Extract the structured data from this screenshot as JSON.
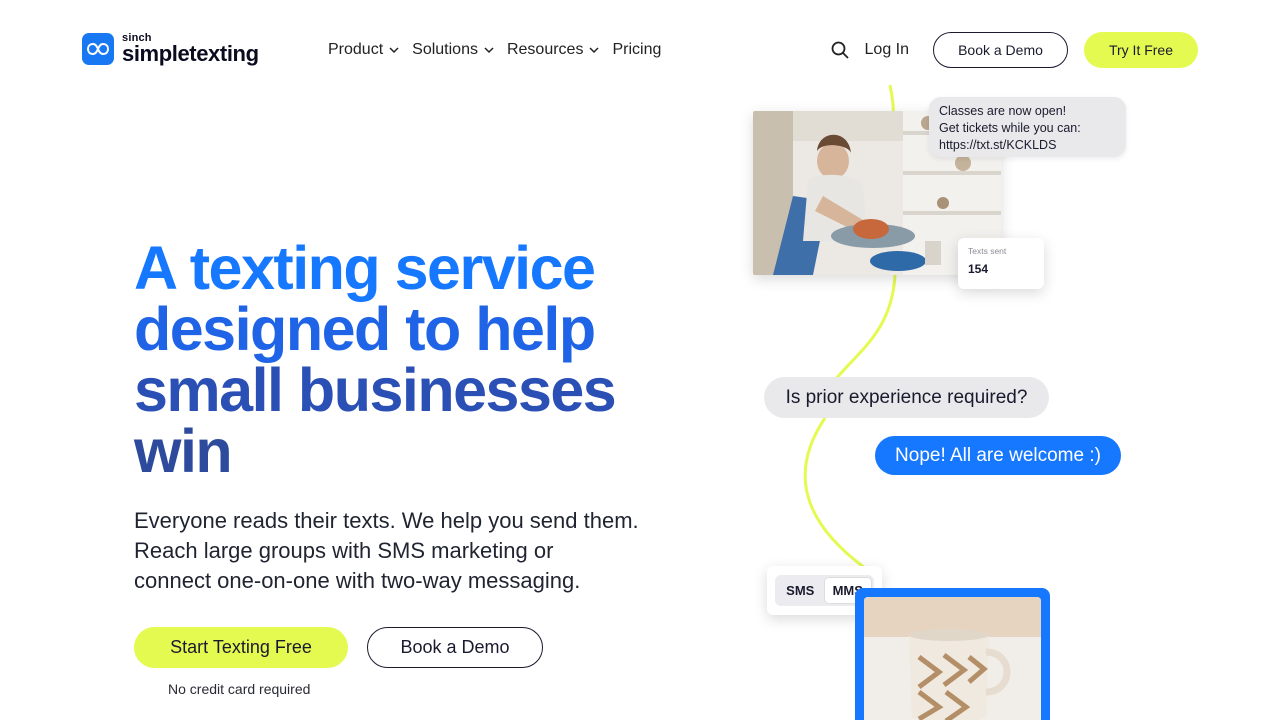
{
  "brand": {
    "small": "sinch",
    "name": "simpletexting",
    "accent": "#1677ff",
    "lime": "#e5fa50"
  },
  "nav": {
    "items": [
      {
        "label": "Product",
        "has_dropdown": true
      },
      {
        "label": "Solutions",
        "has_dropdown": true
      },
      {
        "label": "Resources",
        "has_dropdown": true
      },
      {
        "label": "Pricing",
        "has_dropdown": false
      }
    ],
    "search_icon": "search-icon",
    "login": "Log In",
    "book_demo": "Book a Demo",
    "try_free": "Try It Free"
  },
  "hero": {
    "title_lines": [
      "A texting service",
      "designed to help",
      "small businesses",
      "win"
    ],
    "subtitle_lines": [
      "Everyone reads their texts. We help you send them.",
      "Reach large groups with SMS marketing or",
      "connect one-on-one with two-way messaging."
    ],
    "cta_primary": "Start Texting Free",
    "cta_secondary": "Book a Demo",
    "note": "No credit card required"
  },
  "illustration": {
    "message1_lines": [
      "Classes are now open!",
      "Get tickets while you can:",
      "https://txt.st/KCKLDS"
    ],
    "stat": {
      "label": "Texts sent",
      "value": "154"
    },
    "question": "Is prior experience required?",
    "answer": "Nope! All are welcome :)",
    "toggle": {
      "options": [
        "SMS",
        "MMS"
      ],
      "selected": "MMS"
    }
  }
}
